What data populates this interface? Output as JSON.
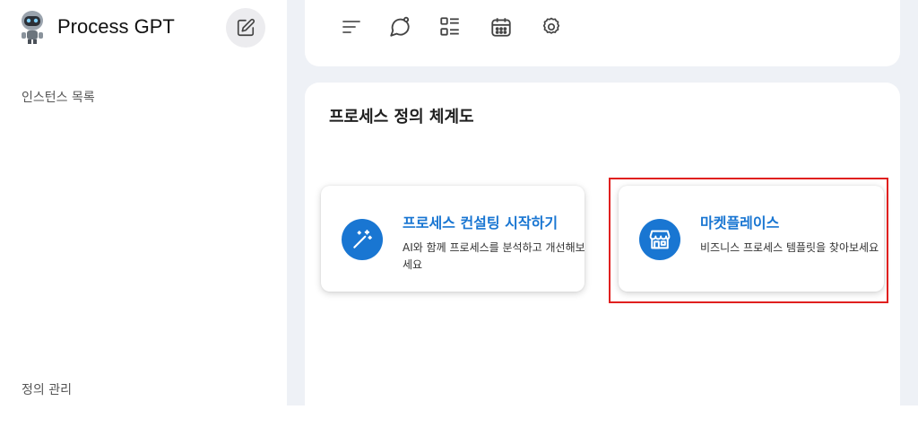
{
  "sidebar": {
    "brand_title": "Process GPT",
    "section_instances": "인스턴스 목록",
    "section_definitions": "정의 관리"
  },
  "toolbar": {
    "icons": [
      "menu-lines-icon",
      "chat-bubble-icon",
      "list-view-icon",
      "calendar-icon",
      "gear-icon"
    ]
  },
  "main": {
    "title": "프로세스 정의 체계도",
    "cards": [
      {
        "title": "프로세스 컨설팅 시작하기",
        "description": "AI와 함께 프로세스를 분석하고 개선해보세요",
        "icon": "magic-wand-icon"
      },
      {
        "title": "마켓플레이스",
        "description": "비즈니스 프로세스 템플릿을 찾아보세요",
        "icon": "storefront-icon"
      }
    ]
  },
  "colors": {
    "accent": "#1976d2",
    "highlight": "#e0201f",
    "background": "#eef1f6"
  }
}
